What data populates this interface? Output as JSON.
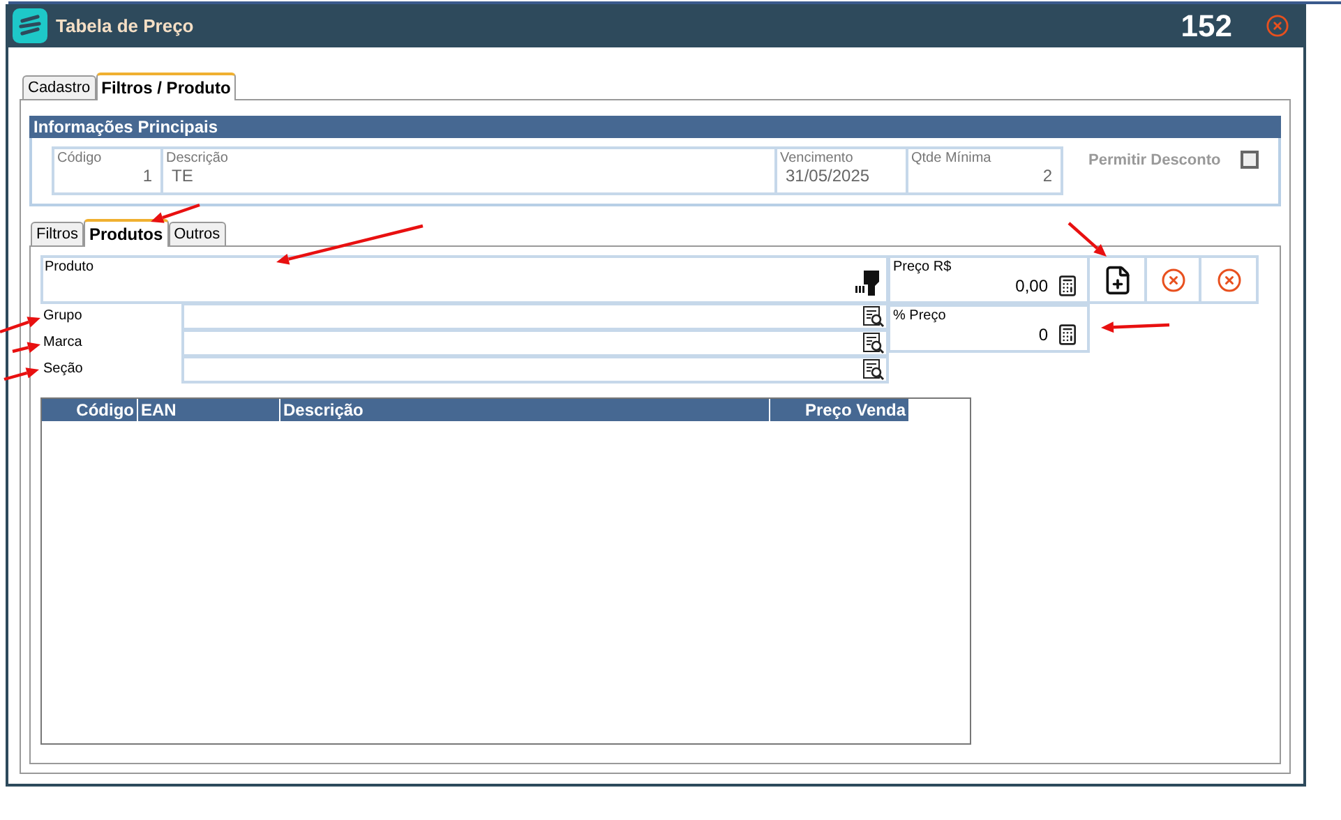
{
  "window": {
    "title": "Tabela de Preço",
    "number": "152"
  },
  "tabs": [
    {
      "label": "Cadastro",
      "selected": false
    },
    {
      "label": "Filtros / Produto",
      "selected": true
    }
  ],
  "main_info": {
    "title": "Informações Principais",
    "fields": [
      {
        "label": "Código",
        "value": "1"
      },
      {
        "label": "Descrição",
        "value": "TE"
      },
      {
        "label": "Vencimento",
        "value": "31/05/2025"
      },
      {
        "label": "Qtde Mínima",
        "value": "2"
      }
    ],
    "permitir_desconto": {
      "label": "Permitir Desconto",
      "checked": false
    }
  },
  "sub_tabs": [
    {
      "label": "Filtros",
      "selected": false
    },
    {
      "label": "Produtos",
      "selected": true
    },
    {
      "label": "Outros",
      "selected": false
    }
  ],
  "produto": {
    "label": "Produto"
  },
  "filters": [
    {
      "label": "Grupo"
    },
    {
      "label": "Marca"
    },
    {
      "label": "Seção"
    }
  ],
  "prices": [
    {
      "label": "Preço R$",
      "value": "0,00"
    },
    {
      "label": "% Preço",
      "value": "0"
    }
  ],
  "table": {
    "columns": [
      {
        "label": "Código"
      },
      {
        "label": "EAN"
      },
      {
        "label": "Descrição"
      },
      {
        "label": "Preço Venda"
      }
    ]
  }
}
